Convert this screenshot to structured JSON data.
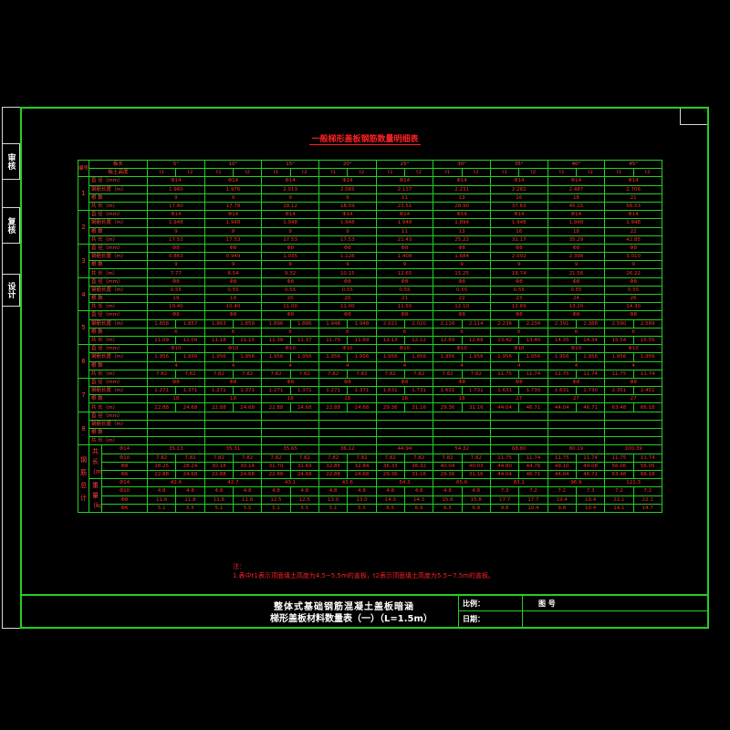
{
  "side_labels": [
    "审核",
    "复核",
    "设计"
  ],
  "title": "一般梯形盖板钢筋数量明细表",
  "header": {
    "corner_top": "板长",
    "corner_mid": "板土高度",
    "corner_left": "编号",
    "groups": [
      "5°",
      "10°",
      "15°",
      "20°",
      "25°",
      "30°",
      "35°",
      "40°",
      "45°"
    ],
    "sub": [
      "t1",
      "t2"
    ]
  },
  "sections": [
    {
      "id": "1",
      "rows": [
        {
          "label": "直 径（mm）",
          "vals": [
            "Φ14",
            "Φ14",
            "Φ14",
            "Φ14",
            "Φ14",
            "Φ14",
            "Φ14",
            "Φ14",
            "Φ14"
          ]
        },
        {
          "label": "钢筋长度（m）",
          "vals": [
            "1.960",
            "1.976",
            "2.013",
            "2.065",
            "2.137",
            "2.231",
            "2.282",
            "2.487",
            "2.706"
          ]
        },
        {
          "label": "根 数",
          "vals": [
            "9",
            "9",
            "9",
            "9",
            "11",
            "13",
            "16",
            "18",
            "21"
          ]
        },
        {
          "label": "共 长（m）",
          "vals": [
            "17.60",
            "17.78",
            "18.12",
            "18.59",
            "23.51",
            "28.90",
            "37.63",
            "45.15",
            "56.53"
          ]
        }
      ]
    },
    {
      "id": "2",
      "rows": [
        {
          "label": "直 径（mm）",
          "vals": [
            "Φ14",
            "Φ14",
            "Φ14",
            "Φ14",
            "Φ14",
            "Φ14",
            "Φ14",
            "Φ14",
            "Φ14"
          ]
        },
        {
          "label": "钢筋长度（m）",
          "vals": [
            "1.948",
            "1.948",
            "1.948",
            "1.948",
            "1.948",
            "1.894",
            "1.948",
            "1.948",
            "1.948"
          ]
        },
        {
          "label": "根 数",
          "vals": [
            "9",
            "9",
            "9",
            "9",
            "11",
            "13",
            "16",
            "18",
            "22"
          ]
        },
        {
          "label": "共 长（m）",
          "vals": [
            "17.53",
            "17.53",
            "17.53",
            "17.53",
            "21.43",
            "25.22",
            "31.17",
            "35.29",
            "42.85"
          ]
        }
      ]
    },
    {
      "id": "3",
      "rows": [
        {
          "label": "直 径（mm）",
          "vals": [
            "Φ8",
            "Φ8",
            "Φ8",
            "Φ8",
            "Φ8",
            "Φ8",
            "Φ8",
            "Φ8",
            "Φ8"
          ]
        },
        {
          "label": "钢筋长度（m）",
          "vals": [
            "0.863",
            "0.949",
            "1.035",
            "1.128",
            "1.408",
            "1.684",
            "2.092",
            "2.398",
            "3.010"
          ]
        },
        {
          "label": "根 数",
          "vals": [
            "9",
            "9",
            "9",
            "9",
            "9",
            "9",
            "9",
            "9",
            "9"
          ]
        },
        {
          "label": "共 长（m）",
          "vals": [
            "7.77",
            "8.54",
            "9.32",
            "10.15",
            "12.65",
            "15.25",
            "18.74",
            "21.56",
            "26.22"
          ]
        }
      ]
    },
    {
      "id": "4",
      "rows": [
        {
          "label": "直 径（mm）",
          "vals": [
            "Φ8",
            "Φ8",
            "Φ8",
            "Φ8",
            "Φ8",
            "Φ8",
            "Φ8",
            "Φ8",
            "Φ8"
          ]
        },
        {
          "label": "钢筋长度（m）",
          "vals": [
            "0.55",
            "0.55",
            "0.55",
            "0.55",
            "0.55",
            "0.55",
            "0.55",
            "0.55",
            "0.55"
          ]
        },
        {
          "label": "根 数",
          "vals": [
            "19",
            "19",
            "20",
            "20",
            "21",
            "22",
            "23",
            "24",
            "26"
          ]
        },
        {
          "label": "共 长（m）",
          "vals": [
            "10.40",
            "10.40",
            "11.00",
            "11.00",
            "11.55",
            "12.10",
            "12.69",
            "13.20",
            "14.30"
          ]
        }
      ]
    },
    {
      "id": "5",
      "rows": [
        {
          "label": "直 径（mm）",
          "vals": [
            "Φ8",
            "Φ8",
            "Φ8",
            "Φ8",
            "Φ8",
            "Φ8",
            "Φ8",
            "Φ8",
            "Φ8"
          ]
        },
        {
          "label": "钢筋长度（m）",
          "pairs": [
            [
              "1.858",
              "1.857"
            ],
            [
              "1.863",
              "1.859"
            ],
            [
              "1.896",
              "1.886"
            ],
            [
              "1.948",
              "1.948"
            ],
            [
              "2.021",
              "2.020"
            ],
            [
              "2.116",
              "2.114"
            ],
            [
              "2.236",
              "2.234"
            ],
            [
              "2.391",
              "2.388"
            ],
            [
              "2.590",
              "2.589"
            ]
          ]
        },
        {
          "label": "根 数",
          "vals": [
            "6",
            "6",
            "6",
            "6",
            "6",
            "6",
            "6",
            "6",
            "6"
          ]
        },
        {
          "label": "共 长（m）",
          "pairs": [
            [
              "11.09",
              "11.09"
            ],
            [
              "11.18",
              "11.15"
            ],
            [
              "11.38",
              "11.37"
            ],
            [
              "11.70",
              "11.69"
            ],
            [
              "12.13",
              "12.12"
            ],
            [
              "12.69",
              "12.68"
            ],
            [
              "13.42",
              "13.40"
            ],
            [
              "14.35",
              "14.34"
            ],
            [
              "15.54",
              "15.55"
            ]
          ]
        }
      ]
    },
    {
      "id": "6",
      "rows": [
        {
          "label": "直 径（mm）",
          "vals": [
            "Φ10",
            "Φ10",
            "Φ10",
            "Φ10",
            "Φ10",
            "Φ10",
            "Φ10",
            "Φ10",
            "Φ10"
          ]
        },
        {
          "label": "钢筋长度（m）",
          "pairs": [
            [
              "1.956",
              "1.956"
            ],
            [
              "1.956",
              "1.956"
            ],
            [
              "1.956",
              "1.956"
            ],
            [
              "1.956",
              "1.956"
            ],
            [
              "1.956",
              "1.956"
            ],
            [
              "1.956",
              "1.956"
            ],
            [
              "1.956",
              "1.956"
            ],
            [
              "1.956",
              "1.956"
            ],
            [
              "1.956",
              "1.956"
            ]
          ]
        },
        {
          "label": "根 数",
          "vals": [
            "4",
            "4",
            "4",
            "4",
            "4",
            "4",
            "4",
            "4",
            "4"
          ]
        },
        {
          "label": "共 长（m）",
          "pairs": [
            [
              "7.82",
              "7.82"
            ],
            [
              "7.82",
              "7.82"
            ],
            [
              "7.82",
              "7.82"
            ],
            [
              "7.82",
              "7.82"
            ],
            [
              "7.82",
              "7.82"
            ],
            [
              "7.82",
              "7.82"
            ],
            [
              "11.75",
              "11.74"
            ],
            [
              "11.75",
              "11.74"
            ],
            [
              "11.75",
              "11.74"
            ]
          ]
        }
      ]
    },
    {
      "id": "7",
      "rows": [
        {
          "label": "直 径（mm）",
          "vals": [
            "Φ8",
            "Φ8",
            "Φ8",
            "Φ8",
            "Φ8",
            "Φ8",
            "Φ8",
            "Φ8",
            "Φ8"
          ]
        },
        {
          "label": "钢筋长度（m）",
          "pairs": [
            [
              "1.271",
              "1.371"
            ],
            [
              "1.271",
              "1.371"
            ],
            [
              "1.271",
              "1.371"
            ],
            [
              "1.271",
              "1.371"
            ],
            [
              "1.631",
              "1.731"
            ],
            [
              "1.631",
              "1.731"
            ],
            [
              "1.631",
              "1.730"
            ],
            [
              "1.631",
              "1.730"
            ],
            [
              "2.351",
              "2.451"
            ]
          ]
        },
        {
          "label": "根 数",
          "vals": [
            "18",
            "18",
            "18",
            "18",
            "18",
            "18",
            "27",
            "27",
            "27"
          ]
        },
        {
          "label": "共 长（m）",
          "pairs": [
            [
              "22.88",
              "24.68"
            ],
            [
              "22.88",
              "24.68"
            ],
            [
              "22.88",
              "24.68"
            ],
            [
              "22.88",
              "24.68"
            ],
            [
              "29.36",
              "31.16"
            ],
            [
              "29.36",
              "31.16"
            ],
            [
              "44.04",
              "46.71"
            ],
            [
              "44.04",
              "46.71"
            ],
            [
              "63.48",
              "66.18"
            ]
          ]
        }
      ]
    },
    {
      "id": "8",
      "rows": [
        {
          "label": "直 径（mm）",
          "vals": [
            "",
            "",
            "",
            "",
            "",
            "",
            "",
            "",
            ""
          ]
        },
        {
          "label": "钢筋长度（m）",
          "vals": [
            "",
            "",
            "",
            "",
            "",
            "",
            "",
            "",
            ""
          ]
        },
        {
          "label": "根 数",
          "vals": [
            "",
            "",
            "",
            "",
            "",
            "",
            "",
            "",
            ""
          ]
        },
        {
          "label": "共 长（m）",
          "vals": [
            "",
            "",
            "",
            "",
            "",
            "",
            "",
            "",
            ""
          ]
        }
      ]
    }
  ],
  "totals": {
    "group_label": "钢筋总计",
    "len_label": "共 长（m）",
    "wt_label": "重 量（kg）",
    "len_rows": [
      {
        "dia": "Φ14",
        "vals": [
          "35.13",
          "35.31",
          "35.65",
          "36.12",
          "44.94",
          "54.32",
          "68.80",
          "80.19",
          "100.39"
        ]
      },
      {
        "dia": "Φ10",
        "pairs": [
          [
            "7.82",
            "7.82"
          ],
          [
            "7.82",
            "7.82"
          ],
          [
            "7.82",
            "7.82"
          ],
          [
            "7.82",
            "7.82"
          ],
          [
            "7.82",
            "7.82"
          ],
          [
            "7.82",
            "7.82"
          ],
          [
            "11.75",
            "11.74"
          ],
          [
            "11.75",
            "11.74"
          ],
          [
            "11.75",
            "11.74"
          ]
        ]
      },
      {
        "dia": "Φ8",
        "pairs": [
          [
            "28.25",
            "28.24"
          ],
          [
            "30.18",
            "30.14"
          ],
          [
            "31.70",
            "31.69"
          ],
          [
            "32.85",
            "32.84"
          ],
          [
            "36.33",
            "36.32"
          ],
          [
            "40.04",
            "40.03"
          ],
          [
            "44.80",
            "44.78"
          ],
          [
            "49.10",
            "49.08"
          ],
          [
            "56.06",
            "56.05"
          ]
        ]
      },
      {
        "dia": "Φ6",
        "pairs": [
          [
            "22.88",
            "24.68"
          ],
          [
            "22.88",
            "24.68"
          ],
          [
            "22.88",
            "24.68"
          ],
          [
            "22.88",
            "24.68"
          ],
          [
            "29.36",
            "31.16"
          ],
          [
            "29.36",
            "31.16"
          ],
          [
            "44.04",
            "46.71"
          ],
          [
            "44.04",
            "46.71"
          ],
          [
            "63.48",
            "66.18"
          ]
        ]
      }
    ],
    "wt_rows": [
      {
        "dia": "Φ14",
        "vals": [
          "42.4",
          "42.7",
          "43.1",
          "43.6",
          "54.3",
          "65.6",
          "83.1",
          "96.9",
          "121.3"
        ]
      },
      {
        "dia": "Φ10",
        "pairs": [
          [
            "4.8",
            "4.8"
          ],
          [
            "4.8",
            "4.8"
          ],
          [
            "4.8",
            "4.8"
          ],
          [
            "4.8",
            "4.8"
          ],
          [
            "4.8",
            "4.8"
          ],
          [
            "4.8",
            "4.8"
          ],
          [
            "7.3",
            "7.2"
          ],
          [
            "7.2",
            "7.3"
          ],
          [
            "7.2",
            "7.2"
          ]
        ]
      },
      {
        "dia": "Φ8",
        "pairs": [
          [
            "11.8",
            "11.8"
          ],
          [
            "11.8",
            "11.8"
          ],
          [
            "12.5",
            "12.5"
          ],
          [
            "13.0",
            "13.0"
          ],
          [
            "14.3",
            "14.3"
          ],
          [
            "15.8",
            "15.8"
          ],
          [
            "17.7",
            "17.7"
          ],
          [
            "19.4",
            "19.4"
          ],
          [
            "22.1",
            "22.1"
          ]
        ]
      },
      {
        "dia": "Φ6",
        "pairs": [
          [
            "5.1",
            "5.5"
          ],
          [
            "5.1",
            "5.5"
          ],
          [
            "5.1",
            "5.5"
          ],
          [
            "5.1",
            "5.5"
          ],
          [
            "6.5",
            "6.9"
          ],
          [
            "6.5",
            "6.9"
          ],
          [
            "9.8",
            "10.4"
          ],
          [
            "9.8",
            "10.4"
          ],
          [
            "14.1",
            "14.7"
          ]
        ]
      }
    ]
  },
  "note_lines": [
    "注：",
    "1.表中t1表示顶面填土高度为4.5~5.5m的盖板，t2表示顶面填土高度为5.5~7.5m的盖板。"
  ],
  "title_block": {
    "line1": "整体式基础钢筋混凝土盖板暗涵",
    "line2": "梯形盖板材料数量表（一）（L=1.5m）",
    "scale_label": "比例：",
    "date_label": "日期：",
    "drawing_no_label": "图  号"
  },
  "colors": {
    "frame": "#22d022",
    "text": "#ff2a2a",
    "bg": "#000000"
  }
}
